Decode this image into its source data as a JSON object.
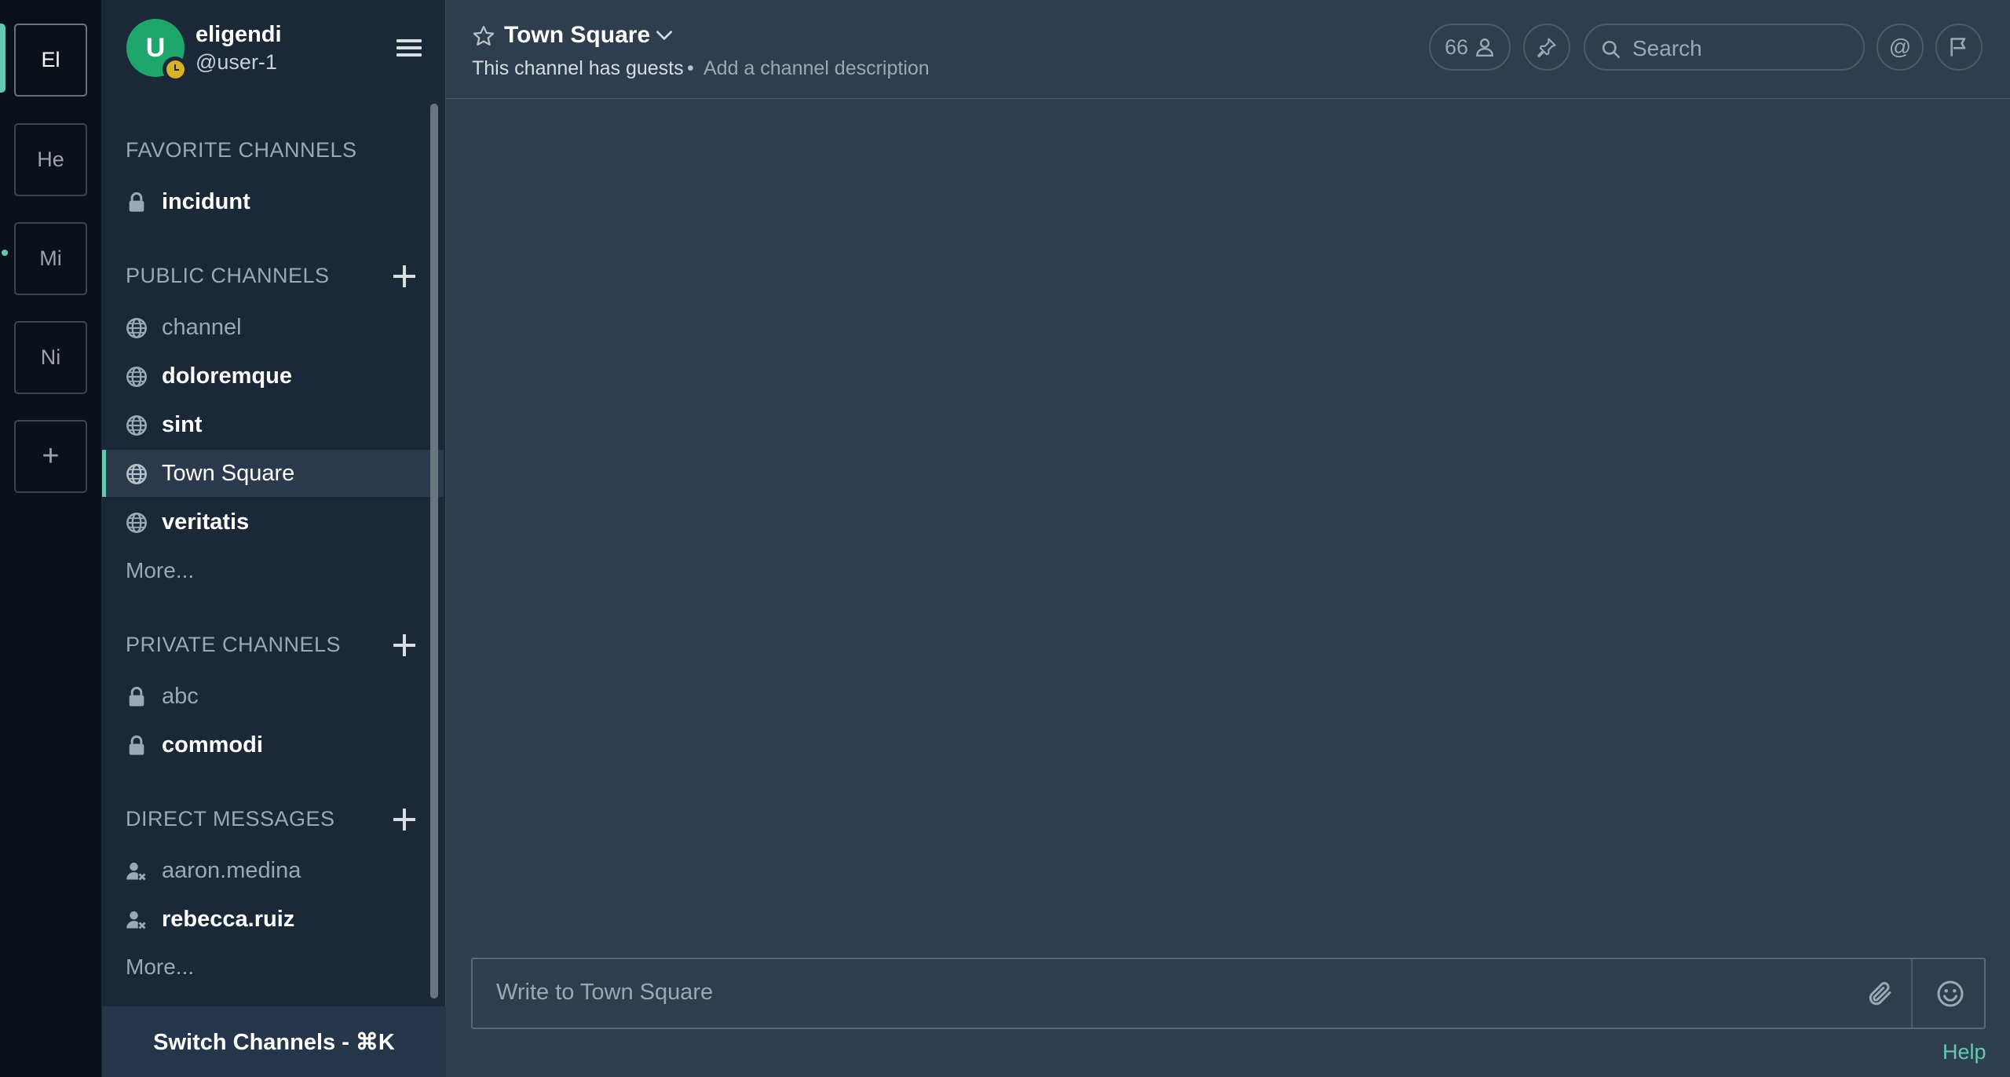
{
  "teams": [
    {
      "label": "El",
      "active": true
    },
    {
      "label": "He",
      "active": false
    },
    {
      "label": "Mi",
      "active": false
    },
    {
      "label": "Ni",
      "active": false
    }
  ],
  "add_team_label": "+",
  "user": {
    "avatar_letter": "U",
    "display_name": "eligendi",
    "username": "@user-1",
    "status": "away"
  },
  "sections": {
    "favorites": {
      "title": "FAVORITE CHANNELS",
      "items": [
        {
          "label": "incidunt",
          "icon": "lock-icon"
        }
      ]
    },
    "public": {
      "title": "PUBLIC CHANNELS",
      "items": [
        {
          "label": "channel",
          "icon": "globe-icon"
        },
        {
          "label": "doloremque",
          "icon": "globe-icon"
        },
        {
          "label": "sint",
          "icon": "globe-icon"
        },
        {
          "label": "Town Square",
          "icon": "globe-icon"
        },
        {
          "label": "veritatis",
          "icon": "globe-icon"
        }
      ],
      "more": "More..."
    },
    "private": {
      "title": "PRIVATE CHANNELS",
      "items": [
        {
          "label": "abc",
          "icon": "lock-icon"
        },
        {
          "label": "commodi",
          "icon": "lock-icon"
        }
      ]
    },
    "direct": {
      "title": "DIRECT MESSAGES",
      "items": [
        {
          "label": "aaron.medina",
          "icon": "deactivated-user-icon"
        },
        {
          "label": "rebecca.ruiz",
          "icon": "deactivated-user-icon"
        }
      ],
      "more": "More..."
    }
  },
  "switch_channels": "Switch Channels - ⌘K",
  "channel_header": {
    "title": "Town Square",
    "guest_notice": "This channel has guests",
    "bullet": "•",
    "description_link": "Add a channel description",
    "member_count": "66",
    "search_placeholder": "Search",
    "at_label": "@"
  },
  "composer": {
    "placeholder": "Write to Town Square"
  },
  "help_link": "Help",
  "colors": {
    "accent": "#65c8b2",
    "sidebar_bg": "#1b2838",
    "main_bg": "#2f3e4e",
    "team_bar_bg": "#0b1118",
    "avatar_bg": "#1fa66d",
    "away_status": "#d8b12b"
  }
}
